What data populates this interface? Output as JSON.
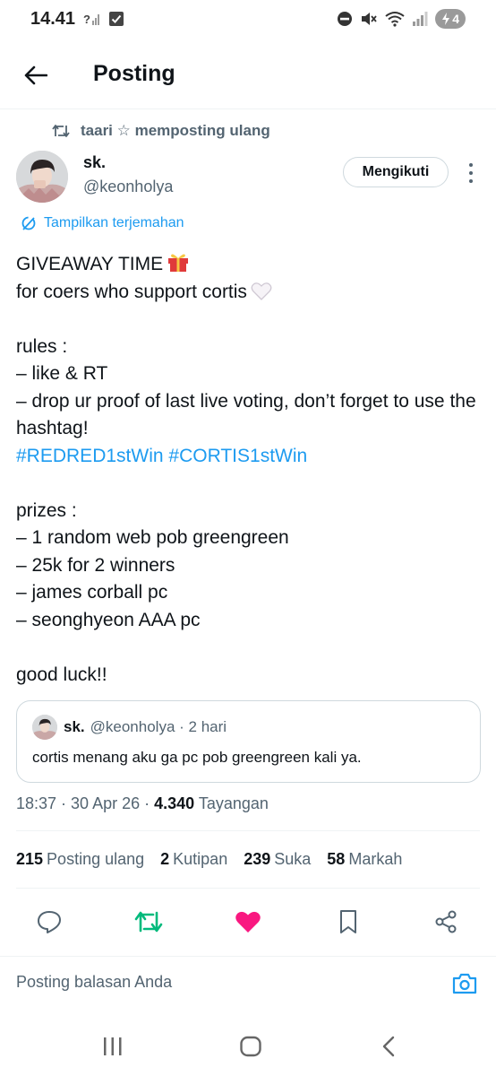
{
  "status_bar": {
    "time": "14.41",
    "battery_level": "4",
    "icons": [
      "wifi-calling-icon",
      "notification-check-icon",
      "dnd-icon",
      "mute-icon",
      "wifi-icon",
      "signal-icon",
      "battery-charging-icon"
    ]
  },
  "header": {
    "title": "Posting",
    "back_icon": "back-arrow-icon"
  },
  "repost": {
    "text": "taari ☆ memposting ulang"
  },
  "author": {
    "name": "sk.",
    "handle": "@keonholya",
    "follow_label": "Mengikuti"
  },
  "translate": {
    "label": "Tampilkan terjemahan"
  },
  "tweet": {
    "line1": "GIVEAWAY TIME",
    "line2": "for coers who support cortis",
    "rules_title": "rules :",
    "rule1": "– like & RT",
    "rule2": "– drop ur proof of last live voting, don’t forget to use the hashtag!",
    "hashtag1": "#REDRED1stWin",
    "hashtag2": "#CORTIS1stWin",
    "prizes_title": "prizes :",
    "prize1": "– 1 random web pob greengreen",
    "prize2": "– 25k for 2 winners",
    "prize3": "– james corball pc",
    "prize4": "– seonghyeon AAA pc",
    "closing": "good luck!!"
  },
  "quote": {
    "name": "sk.",
    "handle_time": "@keonholya · 2 hari",
    "text": "cortis menang aku ga pc pob greengreen kali ya."
  },
  "meta": {
    "time_date": "18:37 · 30 Apr 26 · ",
    "views": "4.340",
    "views_label": " Tayangan"
  },
  "stats": [
    {
      "count": "215",
      "label": "Posting ulang"
    },
    {
      "count": "2",
      "label": "Kutipan"
    },
    {
      "count": "239",
      "label": "Suka"
    },
    {
      "count": "58",
      "label": "Markah"
    }
  ],
  "actions": {
    "reply": "reply-icon",
    "repost": "repost-icon",
    "like": "like-icon",
    "bookmark": "bookmark-icon",
    "share": "share-icon",
    "repost_color": "#00ba7c",
    "like_color": "#f91880"
  },
  "reply_bar": {
    "placeholder": "Posting balasan Anda"
  },
  "colors": {
    "accent": "#1d9bf0",
    "text_primary": "#0f1419",
    "text_secondary": "#536471"
  }
}
